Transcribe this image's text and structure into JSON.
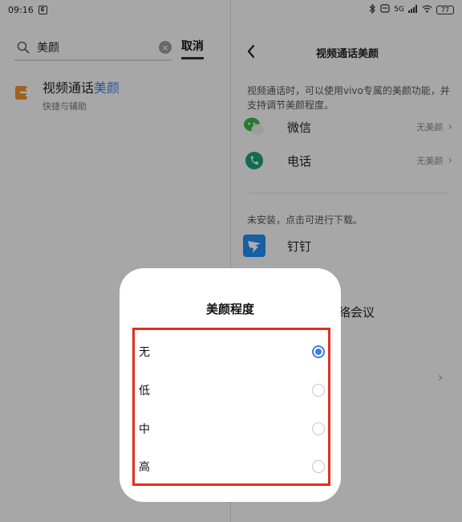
{
  "status_bar": {
    "time": "09:16",
    "notification_badge": "E",
    "network_label": "5G",
    "battery_level": "77"
  },
  "search": {
    "query": "美颜",
    "cancel_label": "取消"
  },
  "search_result": {
    "title_prefix": "视频通话",
    "title_highlight": "美颜",
    "subtitle": "快捷与辅助"
  },
  "detail": {
    "title": "视频通话美颜",
    "description": "视频通话时，可以使用vivo专属的美颜功能，并支持调节美颜程度。",
    "apps": [
      {
        "name": "微信",
        "value": "无美颜",
        "icon": "wechat-icon"
      },
      {
        "name": "电话",
        "value": "无美颜",
        "icon": "phone-icon"
      }
    ],
    "uninstalled_note": "未安装，点击可进行下载。",
    "dingtalk_name": "钉钉",
    "meeting_label_partial": "络会议"
  },
  "dialog": {
    "title": "美颜程度",
    "options": [
      {
        "label": "无",
        "selected": true
      },
      {
        "label": "低",
        "selected": false
      },
      {
        "label": "中",
        "selected": false
      },
      {
        "label": "高",
        "selected": false
      }
    ],
    "highlight_color": "#e0301e",
    "accent_color": "#3d7fe0"
  }
}
